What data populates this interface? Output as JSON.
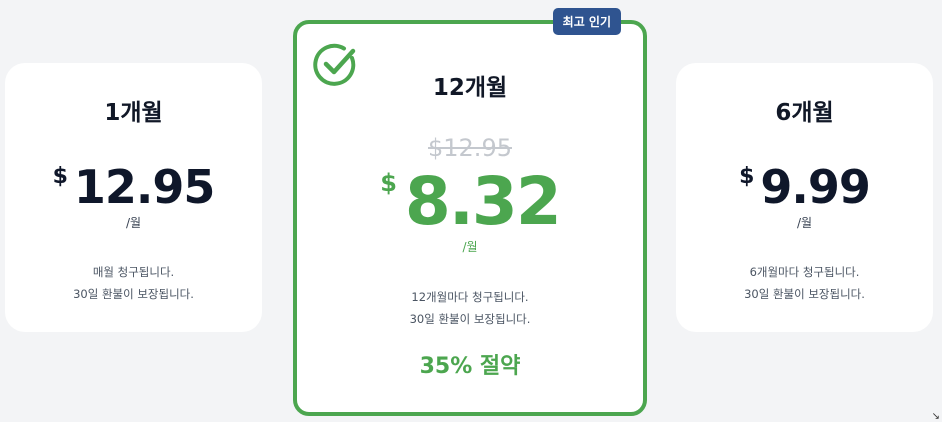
{
  "plans": {
    "monthly": {
      "title": "1개월",
      "currency": "$",
      "price": "12.95",
      "per": "/월",
      "desc_line1": "매월 청구됩니다.",
      "desc_line2": "30일 환불이 보장됩니다."
    },
    "yearly": {
      "badge": "최고 인기",
      "title": "12개월",
      "original_price": "$12.95",
      "currency": "$",
      "price": "8.32",
      "per": "/월",
      "desc_line1": "12개월마다 청구됩니다.",
      "desc_line2": "30일 환불이 보장됩니다.",
      "savings": "35% 절약",
      "check_icon": "check-circle-icon"
    },
    "halfyear": {
      "title": "6개월",
      "currency": "$",
      "price": "9.99",
      "per": "/월",
      "desc_line1": "6개월마다 청구됩니다.",
      "desc_line2": "30일 환불이 보장됩니다."
    }
  },
  "colors": {
    "accent_green": "#4ca64f",
    "badge_blue": "#2f5490",
    "price_dark": "#0f172a",
    "background": "#f3f4f6"
  }
}
